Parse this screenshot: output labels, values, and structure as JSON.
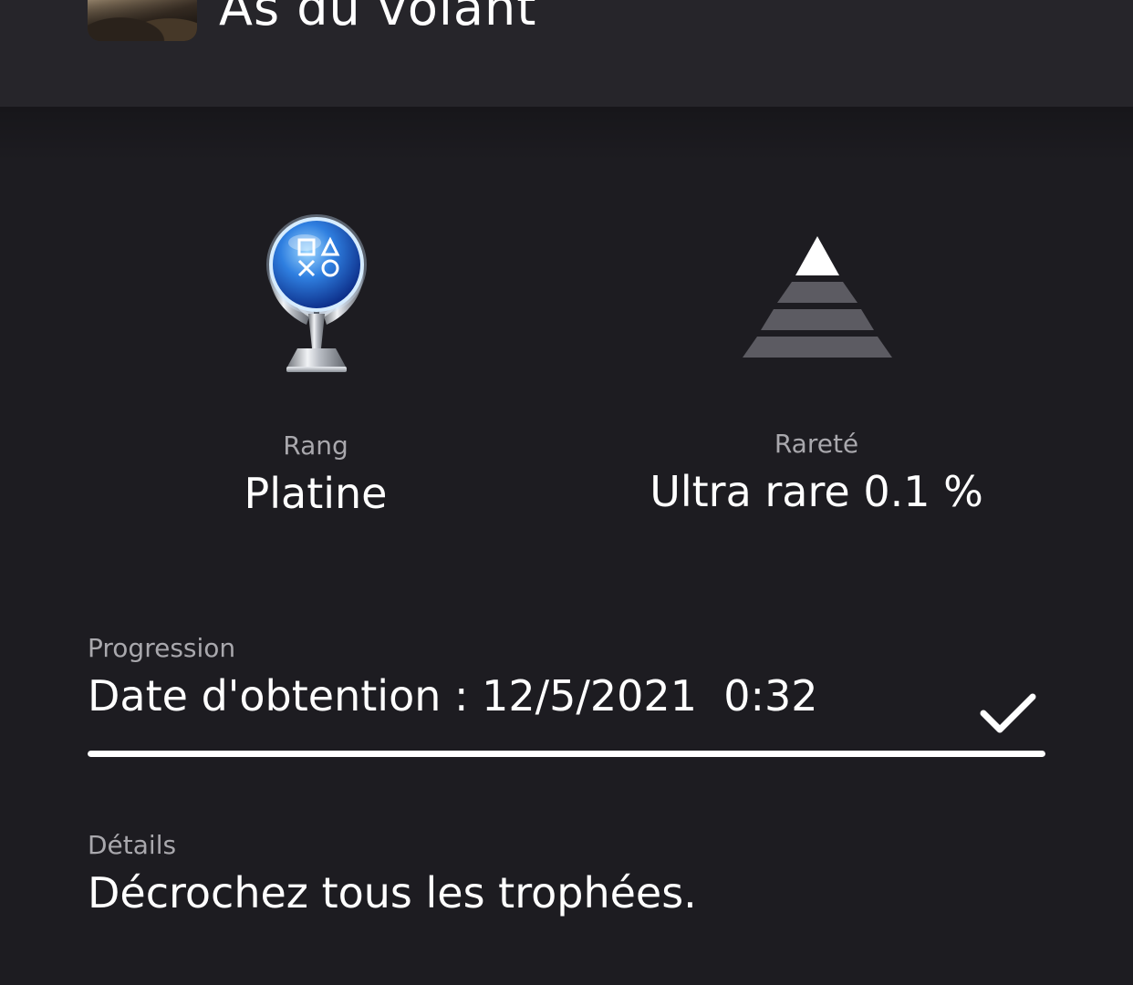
{
  "header": {
    "game_title": "As du volant",
    "thumbnail": "game-cover-thumbnail"
  },
  "trophy": {
    "icon": "platinum-trophy-icon",
    "rank_label": "Rang",
    "rank_value": "Platine"
  },
  "rarity": {
    "icon": "ultra-rare-pyramid-icon",
    "label": "Rareté",
    "value": "Ultra rare 0.1 %"
  },
  "progress": {
    "label": "Progression",
    "value": "Date d'obtention : 12/5/2021  0:32",
    "completion": 1.0,
    "status_icon": "checkmark-icon"
  },
  "details": {
    "label": "Détails",
    "value": "Décrochez tous les trophées."
  },
  "colors": {
    "background": "#1d1c21",
    "header_background": "#26252a",
    "primary_text": "#ffffff",
    "secondary_text": "#a9a8ad"
  }
}
